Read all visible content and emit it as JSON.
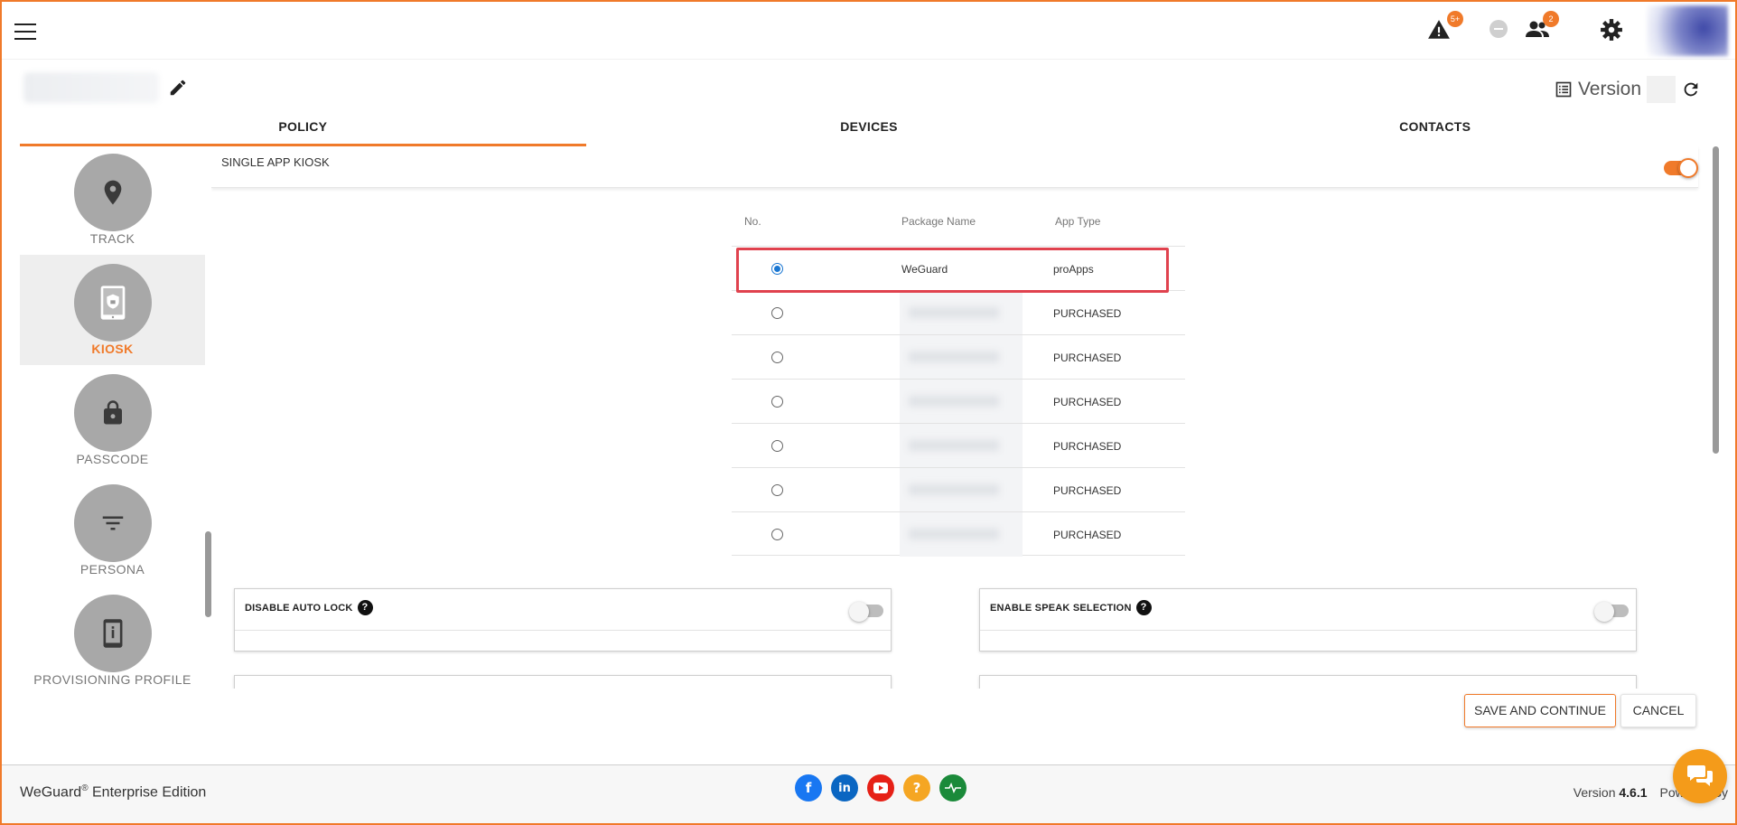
{
  "tabs": [
    {
      "label": "POLICY",
      "active": true
    },
    {
      "label": "DEVICES",
      "active": false
    },
    {
      "label": "CONTACTS",
      "active": false
    }
  ],
  "header": {
    "alerts_badge": "5+",
    "users_badge": "2",
    "version_label": "Version"
  },
  "sidenav": {
    "items": [
      {
        "label": "TRACK",
        "icon": "location-pin-icon",
        "active": false
      },
      {
        "label": "KIOSK",
        "icon": "kiosk-tablet-icon",
        "active": true
      },
      {
        "label": "PASSCODE",
        "icon": "lock-icon",
        "active": false
      },
      {
        "label": "PERSONA",
        "icon": "filter-icon",
        "active": false
      },
      {
        "label": "PROVISIONING PROFILE",
        "icon": "info-phone-icon",
        "active": false
      }
    ]
  },
  "kiosk": {
    "title": "SINGLE APP KIOSK",
    "enabled": true,
    "table": {
      "headers": {
        "no": "No.",
        "package": "Package Name",
        "type": "App Type"
      },
      "rows": [
        {
          "package": "WeGuard",
          "type": "proApps",
          "selected": true
        },
        {
          "package": "",
          "type": "PURCHASED",
          "selected": false
        },
        {
          "package": "",
          "type": "PURCHASED",
          "selected": false
        },
        {
          "package": "",
          "type": "PURCHASED",
          "selected": false
        },
        {
          "package": "",
          "type": "PURCHASED",
          "selected": false
        },
        {
          "package": "",
          "type": "PURCHASED",
          "selected": false
        },
        {
          "package": "",
          "type": "PURCHASED",
          "selected": false
        }
      ]
    },
    "settings": [
      {
        "label": "DISABLE AUTO LOCK",
        "enabled": false
      },
      {
        "label": "ENABLE SPEAK SELECTION",
        "enabled": false
      }
    ]
  },
  "actions": {
    "save": "SAVE AND CONTINUE",
    "cancel": "CANCEL"
  },
  "footer": {
    "brand": "WeGuard",
    "brand_suffix": " Enterprise Edition",
    "version_prefix": "Version ",
    "version": "4.6.1",
    "powered_by": "Powered By",
    "socials": [
      "facebook-icon",
      "linkedin-icon",
      "youtube-icon",
      "help-icon",
      "status-icon"
    ]
  },
  "colors": {
    "accent": "#f07a2a",
    "highlight": "#e0424e",
    "radio_selected": "#1976d2"
  }
}
